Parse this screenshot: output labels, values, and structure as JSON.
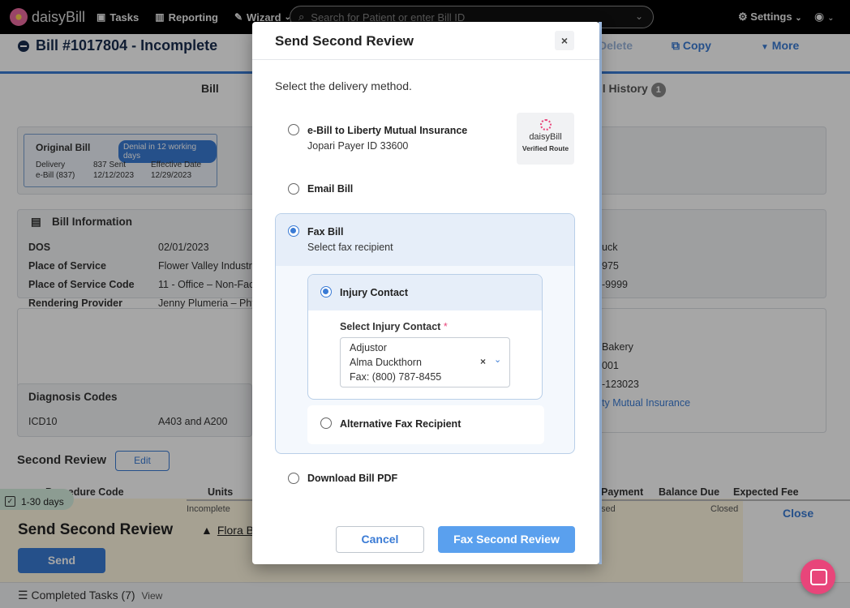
{
  "nav": {
    "brand": "daisyBill",
    "tasks": "Tasks",
    "reporting": "Reporting",
    "wizard": "Wizard",
    "search_placeholder": "Search for Patient or enter Bill ID",
    "settings": "Settings"
  },
  "bill": {
    "title": "Bill #1017804 - Incomplete",
    "actions": {
      "delete": "Delete",
      "copy": "Copy",
      "more": "More"
    },
    "tabs": {
      "bill": "Bill",
      "history": "ill History",
      "history_count": "1"
    },
    "original": {
      "title": "Original Bill",
      "badge": "Denial in 12 working days",
      "delivery_label": "Delivery",
      "delivery_value": "e-Bill (837)",
      "sent_label": "837 Sent",
      "sent_value": "12/12/2023",
      "effective_label": "Effective Date",
      "effective_value": "12/29/2023"
    },
    "info": {
      "title": "Bill Information",
      "rows": [
        {
          "label": "DOS",
          "value": "02/01/2023"
        },
        {
          "label": "Place of Service",
          "value": "Flower Valley Industr"
        },
        {
          "label": "Place of Service Code",
          "value": "11 - Office – Non-Faci"
        },
        {
          "label": "Rendering Provider",
          "value": "Jenny Plumeria – Phy"
        }
      ]
    },
    "right_values": [
      "uck",
      "975",
      "-9999",
      "Bakery",
      "001",
      "-123023",
      "ty Mutual Insurance"
    ],
    "diagnosis": {
      "title": "Diagnosis Codes",
      "label": "ICD10",
      "value": "A403 and A200"
    },
    "second_review": {
      "title": "Second Review",
      "edit": "Edit"
    },
    "table_headers": [
      "Procedure Code",
      "Units",
      "Payment",
      "Balance Due",
      "Expected Fee"
    ]
  },
  "task": {
    "days": "1-30 days",
    "incomplete": "Incomplete",
    "closed_left": "sed",
    "closed": "Closed",
    "title": "Send Second Review",
    "assignee": "Flora Bi",
    "send": "Send",
    "close": "Close",
    "completed_label": "Completed Tasks (7)",
    "completed_view": "View"
  },
  "modal": {
    "title": "Send Second Review",
    "close_glyph": "×",
    "prompt": "Select the delivery method.",
    "options": {
      "ebill_title": "e-Bill to Liberty Mutual Insurance",
      "ebill_sub": "Jopari Payer ID 33600",
      "verified_name": "daisyBill",
      "verified_route": "Verified Route",
      "email": "Email Bill",
      "fax_title": "Fax Bill",
      "fax_sub": "Select fax recipient",
      "injury_contact": "Injury Contact",
      "select_label": "Select Injury Contact",
      "select_lines": [
        "Adjustor",
        "Alma Duckthorn",
        "Fax: (800) 787-8455"
      ],
      "alt_fax": "Alternative Fax Recipient",
      "download": "Download Bill PDF"
    },
    "cancel": "Cancel",
    "submit": "Fax Second Review"
  }
}
